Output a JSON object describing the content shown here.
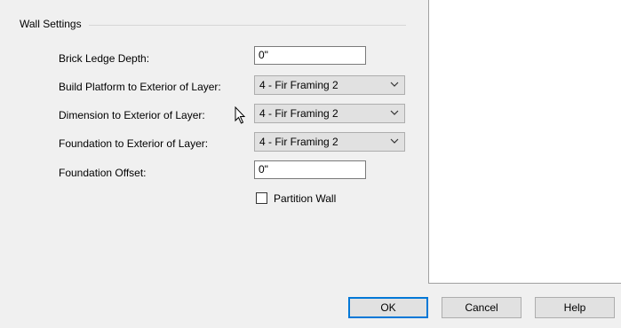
{
  "group": {
    "title": "Wall Settings"
  },
  "fields": {
    "brick_ledge": {
      "label": "Brick Ledge Depth:",
      "value": "0\""
    },
    "build_platform": {
      "label": "Build Platform to Exterior of Layer:",
      "value": "4 - Fir Framing 2"
    },
    "dimension": {
      "label": "Dimension to Exterior of Layer:",
      "value": "4 - Fir Framing 2"
    },
    "foundation": {
      "label": "Foundation to Exterior of Layer:",
      "value": "4 - Fir Framing 2"
    },
    "foundation_offset": {
      "label": "Foundation Offset:",
      "value": "0\""
    }
  },
  "partition_wall": {
    "label": "Partition Wall",
    "checked": false
  },
  "buttons": {
    "ok": "OK",
    "cancel": "Cancel",
    "help": "Help"
  }
}
